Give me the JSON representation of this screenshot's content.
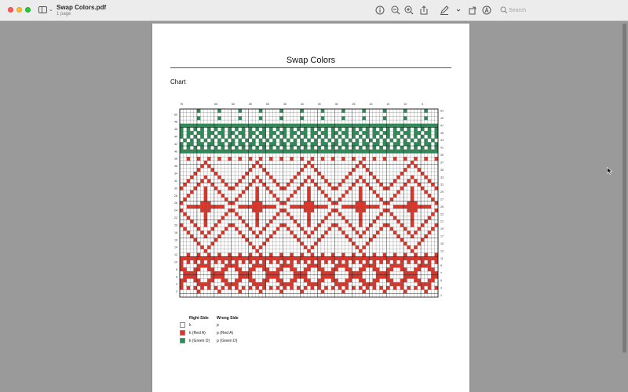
{
  "window": {
    "title": "Swap Colors.pdf",
    "subtitle": "1 page"
  },
  "toolbar": {
    "icons": [
      "sidebar-icon",
      "chevron-down-icon",
      "info-icon",
      "zoom-out-icon",
      "zoom-in-icon",
      "share-icon",
      "markup-icon",
      "chevron-down-icon",
      "rotate-icon",
      "accessibility-icon",
      "search-icon"
    ],
    "search_placeholder": "Search"
  },
  "page": {
    "title": "Swap Colors",
    "section_heading": "Chart"
  },
  "colors": {
    "white": "#ffffff",
    "red": "#d8362a",
    "green": "#2e8a57",
    "grid": "#555555",
    "grid_bold": "#111111"
  },
  "chart_data": {
    "type": "heatmap",
    "columns": 75,
    "rows": 51,
    "top_column_labels": [
      "75",
      "65",
      "60",
      "55",
      "50",
      "45",
      "40",
      "35",
      "30",
      "25",
      "20",
      "15",
      "10",
      "5"
    ],
    "left_row_labels": [
      "50",
      "48",
      "46",
      "44",
      "42",
      "40",
      "38",
      "36",
      "34",
      "32",
      "30",
      "28",
      "26",
      "24",
      "22",
      "20",
      "18",
      "16",
      "14",
      "12",
      "10",
      "8",
      "6",
      "4",
      "2"
    ],
    "right_row_labels": [
      "51",
      "49",
      "47",
      "45",
      "43",
      "41",
      "39",
      "37",
      "35",
      "33",
      "31",
      "29",
      "27",
      "25",
      "23",
      "21",
      "19",
      "17",
      "15",
      "13",
      "11",
      "9",
      "7",
      "5",
      "3",
      "1"
    ],
    "bands": [
      {
        "rows": [
          1,
          2
        ],
        "color": "red",
        "pattern": "dots"
      },
      {
        "rows": [
          3,
          10
        ],
        "color": "red",
        "pattern": "diamond-border"
      },
      {
        "rows": [
          11,
          11
        ],
        "color": "red",
        "pattern": "solid"
      },
      {
        "rows": [
          12,
          38
        ],
        "color": "red",
        "pattern": "large-motif"
      },
      {
        "rows": [
          39,
          39
        ],
        "color": "white",
        "pattern": "empty"
      },
      {
        "rows": [
          40,
          47
        ],
        "color": "green",
        "pattern": "checker-band"
      },
      {
        "rows": [
          48,
          51
        ],
        "color": "green",
        "pattern": "dots"
      }
    ]
  },
  "legend": {
    "header_right": "Right Side",
    "header_wrong": "Wrong Side",
    "items": [
      {
        "color": "white",
        "right": "k",
        "wrong": "p"
      },
      {
        "color": "red",
        "right": "k (Red A)",
        "wrong": "p (Red A)"
      },
      {
        "color": "green",
        "right": "k (Green D)",
        "wrong": "p (Green D)"
      }
    ]
  }
}
